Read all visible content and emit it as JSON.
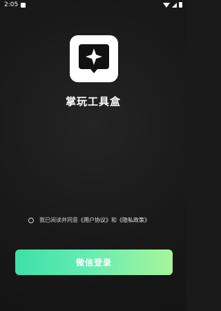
{
  "status_bar": {
    "time": "2:05"
  },
  "app": {
    "title": "掌玩工具盒",
    "logo_icon": "sparkle-chat-bubble-icon"
  },
  "agreement": {
    "prefix": "我已阅读并同意",
    "user_agreement": "《用户协议》",
    "and": "和",
    "privacy_policy": "《隐私政策》"
  },
  "login": {
    "label": "微信登录"
  },
  "colors": {
    "background": "#1a1a1a",
    "button_start": "#3ee0a7",
    "button_end": "#a8f59a",
    "logo_bg": "#ffffff"
  }
}
